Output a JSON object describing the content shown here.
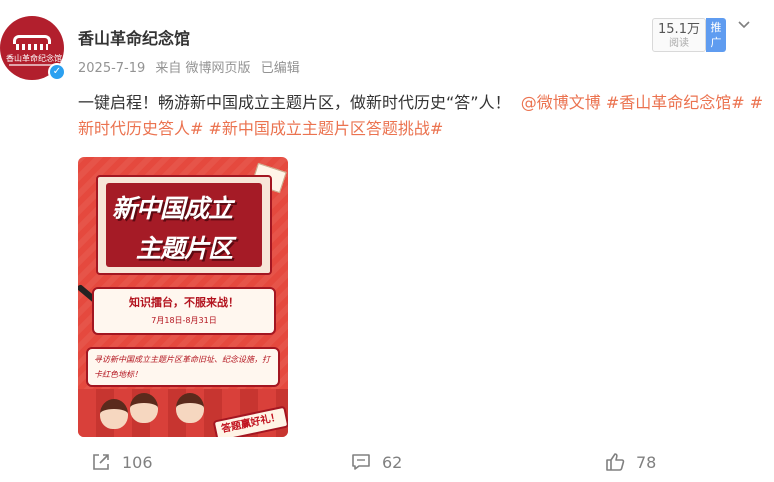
{
  "colors": {
    "accent_tag": "#eb7350",
    "verified": "#2ba0f0",
    "promo_bg": "#5f9cf0",
    "poster_red": "#e5493e",
    "poster_dark_red": "#a51b26"
  },
  "account": {
    "name": "香山革命纪念馆",
    "avatar_text": "香山革命纪念馆",
    "verified_icon": "verified-badge-icon"
  },
  "meta": {
    "date": "2025-7-19",
    "source": "来自 微博网页版",
    "edited": "已编辑"
  },
  "stats": {
    "views_num": "15.1万",
    "views_label": "阅读",
    "promo_label": "推广"
  },
  "post": {
    "text_plain": "一键启程！畅游新中国成立主题片区，做新时代历史“答”人！",
    "mention": "@微博文博",
    "tag1": "#香山革命纪念馆#",
    "tag2": "#新时代历史答人#",
    "tag3": "#新中国成立主题片区答题挑战#"
  },
  "poster": {
    "title_line1": "新中国成立",
    "title_line2": "主题片区",
    "slogan": "知识擂台，不服来战！",
    "dates": "7月18日-8月31日",
    "description": "寻访新中国成立主题片区革命旧址、纪念设施，打卡红色地标！",
    "badge": "答题赢好礼！"
  },
  "actions": {
    "share_count": "106",
    "comment_count": "62",
    "like_count": "78"
  }
}
